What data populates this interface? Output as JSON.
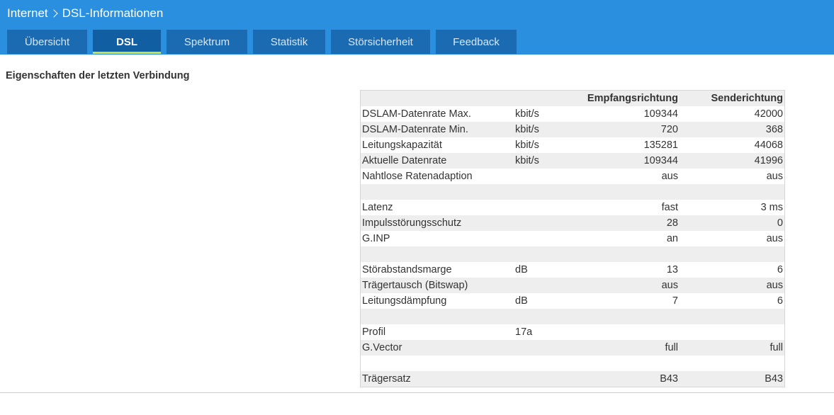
{
  "breadcrumb": {
    "parent": "Internet",
    "current": "DSL-Informationen"
  },
  "tabs": [
    {
      "label": "Übersicht",
      "active": false
    },
    {
      "label": "DSL",
      "active": true
    },
    {
      "label": "Spektrum",
      "active": false
    },
    {
      "label": "Statistik",
      "active": false
    },
    {
      "label": "Störsicherheit",
      "active": false
    },
    {
      "label": "Feedback",
      "active": false
    }
  ],
  "section": {
    "title": "Eigenschaften der letzten Verbindung"
  },
  "table": {
    "headers": {
      "rx": "Empfangsrichtung",
      "tx": "Senderichtung"
    },
    "rows": [
      {
        "label": "DSLAM-Datenrate Max.",
        "unit": "kbit/s",
        "rx": "109344",
        "tx": "42000"
      },
      {
        "label": "DSLAM-Datenrate Min.",
        "unit": "kbit/s",
        "rx": "720",
        "tx": "368"
      },
      {
        "label": "Leitungskapazität",
        "unit": "kbit/s",
        "rx": "135281",
        "tx": "44068"
      },
      {
        "label": "Aktuelle Datenrate",
        "unit": "kbit/s",
        "rx": "109344",
        "tx": "41996"
      },
      {
        "label": "Nahtlose Ratenadaption",
        "unit": "",
        "rx": "aus",
        "tx": "aus"
      },
      {
        "label": "",
        "unit": "",
        "rx": "",
        "tx": ""
      },
      {
        "label": "Latenz",
        "unit": "",
        "rx": "fast",
        "tx": "3 ms"
      },
      {
        "label": "Impulsstörungsschutz",
        "unit": "",
        "rx": "28",
        "tx": "0"
      },
      {
        "label": "G.INP",
        "unit": "",
        "rx": "an",
        "tx": "aus"
      },
      {
        "label": "",
        "unit": "",
        "rx": "",
        "tx": ""
      },
      {
        "label": "Störabstandsmarge",
        "unit": "dB",
        "rx": "13",
        "tx": "6"
      },
      {
        "label": "Trägertausch (Bitswap)",
        "unit": "",
        "rx": "aus",
        "tx": "aus"
      },
      {
        "label": "Leitungsdämpfung",
        "unit": "dB",
        "rx": "7",
        "tx": "6"
      },
      {
        "label": "",
        "unit": "",
        "rx": "",
        "tx": ""
      },
      {
        "label": "Profil",
        "unit": "17a",
        "rx": "",
        "tx": ""
      },
      {
        "label": "G.Vector",
        "unit": "",
        "rx": "full",
        "tx": "full"
      },
      {
        "label": "",
        "unit": "",
        "rx": "",
        "tx": ""
      },
      {
        "label": "Trägersatz",
        "unit": "",
        "rx": "B43",
        "tx": "B43"
      }
    ]
  }
}
